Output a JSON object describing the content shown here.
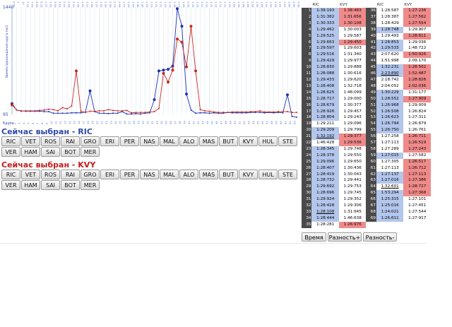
{
  "chart": {
    "ytop": "1440",
    "ybottom": "95",
    "ylabel": "Время прохождения круга (мс)",
    "xlabel": "Круги",
    "top_labels": [
      "0:53",
      "4",
      "17",
      "7:15",
      "7:09",
      "6:06",
      "5:25",
      "4:37",
      "4:05",
      "3:39",
      "3:03",
      "2:44",
      "2:28",
      "2:13",
      "1:48",
      "1:31",
      "1:21",
      "1:08",
      "3:37",
      "2:52",
      "2:39",
      "2:28",
      "2:19",
      "2:09",
      "1:57",
      "1:49",
      "1:44",
      "1:36",
      "1:30",
      "1:26",
      "1:23",
      "1:22",
      "1:21",
      "1:19",
      "1:19",
      "1:18",
      "1:17",
      "1:18",
      "1:16",
      "1:15",
      "1:15",
      "1:14",
      "1:13",
      "1:12",
      "1:12",
      "1:11",
      "1:11",
      "1:10",
      "1:09",
      "1:09",
      "1:08",
      "1:08",
      "1:06",
      "1:05",
      "1:05",
      "1:04",
      "1:03",
      "1:03",
      "1:02",
      "1:01",
      "1:00",
      "0:59",
      "0:59"
    ],
    "bottom_labels": [
      "1",
      "2",
      "3",
      "4",
      "5",
      "6",
      "7",
      "8",
      "9",
      "10",
      "11",
      "12",
      "13",
      "14",
      "15",
      "16",
      "17",
      "18",
      "19",
      "20",
      "21",
      "22",
      "23",
      "24",
      "25",
      "26",
      "27",
      "28",
      "29",
      "30",
      "31",
      "32",
      "33",
      "34",
      "35",
      "36",
      "37",
      "38",
      "39",
      "40",
      "41",
      "42",
      "43",
      "44",
      "45",
      "46",
      "47",
      "48",
      "49",
      "50",
      "51",
      "52",
      "53",
      "54",
      "55",
      "56",
      "57",
      "58",
      "59",
      "60",
      "61",
      "62",
      "63"
    ],
    "colors": {
      "ric": "#1e32b4",
      "kvy": "#c8281e",
      "axis": "#9ab3e0",
      "grid": "#d3e0f3"
    }
  },
  "chart_data": {
    "type": "line",
    "xlabel": "Круги",
    "ylabel": "Время прохождения круга (мс)",
    "ylim": [
      95,
      1440
    ],
    "x": [
      1,
      2,
      3,
      4,
      5,
      6,
      7,
      8,
      9,
      10,
      11,
      12,
      13,
      14,
      15,
      16,
      17,
      18,
      19,
      20,
      21,
      22,
      23,
      24,
      25,
      26,
      27,
      28,
      29,
      30,
      31,
      32,
      33,
      34,
      35,
      36,
      37,
      38,
      39,
      40,
      41,
      42,
      43,
      44,
      45,
      46,
      47,
      48,
      49,
      50,
      51,
      52,
      53,
      54,
      55,
      56,
      57,
      58,
      59,
      60,
      61,
      62,
      63
    ],
    "series": [
      {
        "name": "RIC",
        "values": [
          230,
          150,
          140,
          135,
          135,
          135,
          135,
          130,
          130,
          110,
          110,
          110,
          110,
          115,
          115,
          115,
          125,
          390,
          130,
          110,
          110,
          105,
          110,
          110,
          130,
          100,
          100,
          105,
          100,
          110,
          115,
          280,
          640,
          650,
          660,
          700,
          1420,
          1200,
          350,
          150,
          110,
          115,
          115,
          110,
          115,
          110,
          110,
          120,
          115,
          115,
          115,
          115,
          120,
          120,
          120,
          115,
          120,
          115,
          120,
          115,
          340,
          70,
          60
        ]
      },
      {
        "name": "KVY",
        "values": [
          215,
          150,
          135,
          140,
          140,
          140,
          145,
          150,
          160,
          155,
          140,
          180,
          165,
          200,
          640,
          135,
          120,
          135,
          135,
          140,
          140,
          155,
          145,
          140,
          140,
          145,
          115,
          120,
          120,
          120,
          125,
          130,
          170,
          610,
          500,
          650,
          1040,
          1000,
          690,
          1200,
          640,
          155,
          140,
          135,
          125,
          120,
          120,
          120,
          125,
          125,
          125,
          125,
          130,
          130,
          140,
          125,
          125,
          125,
          130,
          130,
          130,
          120,
          120
        ]
      }
    ]
  },
  "sections": [
    {
      "title": "Сейчас выбран - RIC",
      "color": "#2f49ac"
    },
    {
      "title": "Сейчас выбран - KVY",
      "color": "#c41b1b"
    }
  ],
  "buttons": [
    "RIC",
    "VET",
    "ROS",
    "RAI",
    "GRO",
    "ERI",
    "PER",
    "NAS",
    "MAL",
    "ALO",
    "MAS",
    "BUT",
    "KVY",
    "HUL",
    "STE",
    "VER",
    "HAM",
    "SAI",
    "BOT",
    "MER"
  ],
  "table": {
    "headers": [
      "RIC",
      "KVY",
      "RIC",
      "KVY"
    ],
    "rows": [
      [
        1,
        "1:39:193",
        "1:38:483",
        36,
        "1:28:587",
        "1:27:236"
      ],
      [
        2,
        "1:31:382",
        "1:31:656",
        37,
        "1:28:387",
        "1:27:562"
      ],
      [
        3,
        "1:30:333",
        "1:30:108",
        38,
        "1:28:429",
        "1:27:554"
      ],
      [
        4,
        "1:29:462",
        "1:30:003",
        39,
        "1:28:748",
        "1:29:907"
      ],
      [
        5,
        "1:29:525",
        "1:29:587",
        40,
        "1:29:493",
        "1:28:811"
      ],
      [
        6,
        "1:29:663",
        "1:29:450",
        41,
        "1:28:853",
        "1:29:036"
      ],
      [
        7,
        "1:29:597",
        "1:29:603",
        42,
        "1:29:533",
        "1:48:722"
      ],
      [
        8,
        "1:29:516",
        "1:31:340",
        43,
        "2:07:620",
        "1:50:926"
      ],
      [
        9,
        "1:29:429",
        "1:29:977",
        44,
        "1:51:998",
        "2:09:170"
      ],
      [
        10,
        "1:28:830",
        "1:29:888",
        45,
        "1:32:231",
        "1:28:502"
      ],
      [
        11,
        "1:28:088",
        "1:30:616",
        46,
        "2:23:890",
        "1:52:487"
      ],
      [
        12,
        "1:29:433",
        "1:29:620",
        47,
        "2:18:742",
        "1:28:826"
      ],
      [
        13,
        "1:28:408",
        "1:32:718",
        48,
        "2:04:052",
        "2:02:036"
      ],
      [
        14,
        "1:28:625",
        "1:48:099",
        49,
        "1:30:229",
        "1:31:177"
      ],
      [
        15,
        "1:28:717",
        "1:29:000",
        50,
        "1:28:552",
        "1:27:909"
      ],
      [
        16,
        "1:28:679",
        "1:30:377",
        51,
        "1:26:968",
        "1:29:009"
      ],
      [
        17,
        "1:28:926",
        "1:29:457",
        52,
        "1:26:508",
        "1:26:824"
      ],
      [
        18,
        "1:28:804",
        "1:29:243",
        53,
        "1:26:623",
        "1:27:311"
      ],
      [
        19,
        "1:29:211",
        "1:29:096",
        54,
        "1:26:794",
        "1:26:879"
      ],
      [
        20,
        "1:29:209",
        "1:29:799",
        55,
        "1:26:750",
        "1:26:761"
      ],
      [
        21,
        "1:32:192",
        "1:29:377",
        56,
        "1:27:258",
        "1:26:711"
      ],
      [
        22,
        "1:46:428",
        "1:29:536",
        57,
        "1:27:113",
        "1:26:519"
      ],
      [
        23,
        "1:28:345",
        "1:29:748",
        58,
        "1:27:289",
        "1:27:243"
      ],
      [
        24,
        "1:28:378",
        "1:29:550",
        59,
        "1:27:015",
        "1:27:582"
      ],
      [
        25,
        "1:29:096",
        "1:29:650",
        60,
        "1:27:305",
        "1:26:517"
      ],
      [
        26,
        "1:28:407",
        "1:30:436",
        61,
        "1:27:113",
        "1:26:712"
      ],
      [
        27,
        "1:28:419",
        "1:30:043",
        62,
        "1:27:137",
        "1:27:113"
      ],
      [
        28,
        "1:28:732",
        "1:29:441",
        63,
        "1:27:016",
        "1:27:386"
      ],
      [
        29,
        "1:29:692",
        "1:29:753",
        64,
        "1:32:601",
        "1:28:727"
      ],
      [
        30,
        "1:28:696",
        "1:29:745",
        65,
        "1:53:294",
        "1:27:368"
      ],
      [
        31,
        "1:29:924",
        "1:29:352",
        66,
        "1:25:315",
        "1:27:101"
      ],
      [
        32,
        "1:28:428",
        "1:29:306",
        67,
        "1:25:016",
        "1:27:451"
      ],
      [
        33,
        "1:28:108",
        "1:31:945",
        68,
        "1:24:021",
        "1:27:544"
      ],
      [
        34,
        "1:28:444",
        "1:46:638",
        69,
        "1:26:611",
        "1:27:917"
      ],
      [
        35,
        "1:28:281",
        "1:26:976",
        null,
        "",
        ""
      ]
    ],
    "highlights": {
      "blue": [
        "0-1",
        "1-1",
        "2-1",
        "3-1",
        "4-1",
        "5-1",
        "6-1",
        "7-1",
        "8-1",
        "9-1",
        "10-1",
        "11-1",
        "12-1",
        "13-1",
        "14-1",
        "15-1",
        "16-1",
        "17-1",
        "19-1",
        "20-1",
        "22-1",
        "23-1",
        "24-1",
        "25-1",
        "26-1",
        "27-1",
        "28-1",
        "29-1",
        "30-1",
        "31-1",
        "32-1",
        "33-1",
        "3-4",
        "5-4",
        "6-4",
        "9-4",
        "10-4",
        "13-4",
        "14-4",
        "15-4",
        "16-4",
        "17-4",
        "18-4",
        "19-4",
        "23-4",
        "26-4",
        "27-4",
        "29-4",
        "30-4",
        "31-4",
        "32-4",
        "33-4"
      ],
      "red": [
        "0-2",
        "1-2",
        "2-2",
        "4-5",
        "7-5",
        "9-5",
        "10-5",
        "11-5",
        "12-5",
        "14-5",
        "20-5",
        "21-5",
        "22-5",
        "24-5",
        "25-5",
        "26-5",
        "27-5",
        "28-5",
        "29-5",
        "0-5",
        "1-5",
        "2-5",
        "5-2",
        "20-2",
        "21-2",
        "34-2"
      ],
      "under": [
        "20-1",
        "10-4",
        "28-4",
        "32-1"
      ]
    }
  },
  "footer": {
    "btn1": "Время",
    "btn2": "Разность+",
    "btn3": "Разность-"
  }
}
